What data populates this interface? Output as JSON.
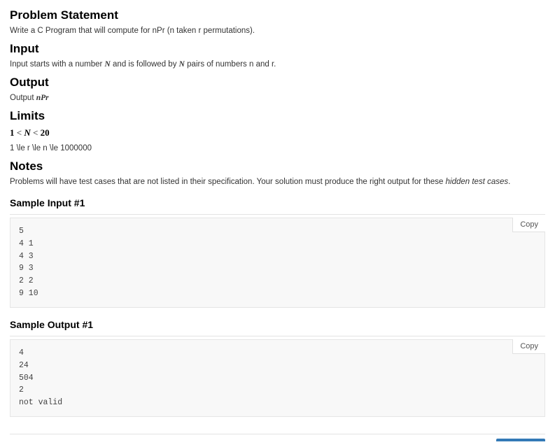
{
  "headings": {
    "problem_statement": "Problem Statement",
    "input": "Input",
    "output": "Output",
    "limits": "Limits",
    "notes": "Notes",
    "sample_input_1": "Sample Input #1",
    "sample_output_1": "Sample Output #1"
  },
  "body": {
    "problem_text": "Write a C Program that will compute for nPr (n taken r permutations).",
    "input_prefix": "Input starts with a number ",
    "input_mid": " and is followed by ",
    "input_suffix": " pairs of numbers n and r.",
    "input_symbol_N": "N",
    "output_prefix": "Output ",
    "output_formula_n": "n",
    "output_formula_P": "P",
    "output_formula_r": "r",
    "limits_line1_lt1": "1",
    "limits_line1_lt_sym1": " < ",
    "limits_line1_N": "N",
    "limits_line1_lt_sym2": " < ",
    "limits_line1_20": "20",
    "limits_line2": "1 \\le r \\le n \\le 1000000",
    "notes_prefix": "Problems will have test cases that are not listed in their specification. Your solution must produce the right output for these ",
    "notes_hidden": "hidden test cases",
    "notes_suffix": "."
  },
  "samples": {
    "input1": "5\n4 1\n4 3\n9 3\n2 2\n9 10",
    "output1": "4\n24\n504\n2\nnot valid"
  },
  "buttons": {
    "copy": "Copy"
  }
}
